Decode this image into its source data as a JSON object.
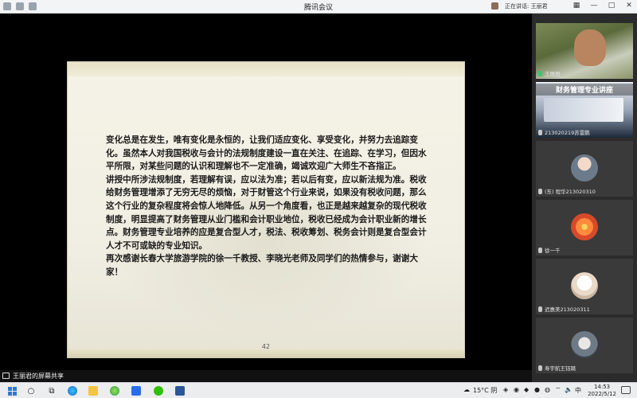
{
  "window": {
    "title": "腾讯会议",
    "speaking_label": "正在讲话: 王丽君"
  },
  "slide": {
    "paragraphs": [
      "变化总是在发生，唯有变化是永恒的，让我们适应变化、享受变化，并努力去追踪变化。虽然本人对我国税收与会计的法规制度建设一直在关注、在追踪、在学习，但因水平所限，对某些问题的认识和理解也不一定准确，竭诚欢迎广大师生不吝指正。",
      "讲授中所涉法规制度，若理解有误，应以法为准；若以后有变，应以新法规为准。税收给财务管理增添了无穷无尽的烦恼，对于财管这个行业来说，如果没有税收问题，那么这个行业的复杂程度将会惊人地降低。从另一个角度看，也正是越来越复杂的现代税收制度，明显提高了财务管理从业门槛和会计职业地位，税收已经成为会计职业新的增长点。财务管理专业培养的应是复合型人才，税法、税收筹划、税务会计则是复合型会计人才不可或缺的专业知识。",
      "再次感谢长春大学旅游学院的徐一千教授、李晓光老师及同学们的热情参与，谢谢大家！"
    ],
    "page_number": "42"
  },
  "participants": [
    {
      "name": "王丽君",
      "type": "video"
    },
    {
      "name": "213020219苏雷鹏",
      "type": "video",
      "banner": "财务管理专业讲座"
    },
    {
      "name": "(东) 程华213020310",
      "type": "avatar"
    },
    {
      "name": "徐一千",
      "type": "avatar"
    },
    {
      "name": "迟惠美213020311",
      "type": "avatar"
    },
    {
      "name": "寿宇航王钰璐",
      "type": "avatar"
    }
  ],
  "share_bar": {
    "label": "王丽君的屏幕共享"
  },
  "taskbar": {
    "weather": "15°C 阴",
    "ime": "中",
    "time": "14:53",
    "date": "2022/5/12"
  }
}
